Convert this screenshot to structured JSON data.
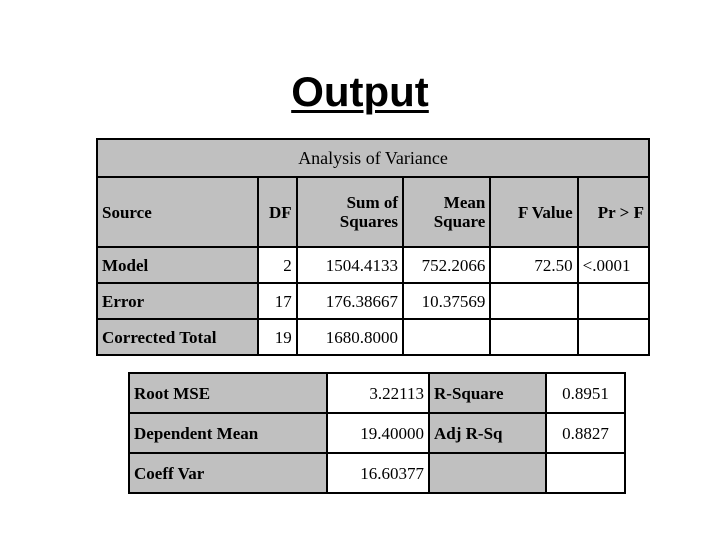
{
  "slide": {
    "title": "Output",
    "background_color": "#ffffff",
    "header_fill_color": "#c0c0c0",
    "border_color": "#000000"
  },
  "anova": {
    "caption": "Analysis of Variance",
    "columns": [
      {
        "line1": "",
        "line2": "Source"
      },
      {
        "line1": "",
        "line2": "DF"
      },
      {
        "line1": "Sum of",
        "line2": "Squares"
      },
      {
        "line1": "Mean",
        "line2": "Square"
      },
      {
        "line1": "",
        "line2": "F Value"
      },
      {
        "line1": "",
        "line2": "Pr > F"
      }
    ],
    "rows": [
      {
        "source": "Model",
        "df": "2",
        "sum_of_squares": "1504.4133",
        "mean_square": "752.2066",
        "f_value": "72.50",
        "pr_f": "<.0001"
      },
      {
        "source": "Error",
        "df": "17",
        "sum_of_squares": "176.38667",
        "mean_square": "10.37569",
        "f_value": "",
        "pr_f": ""
      },
      {
        "source": "Corrected Total",
        "df": "19",
        "sum_of_squares": "1680.8000",
        "mean_square": "",
        "f_value": "",
        "pr_f": ""
      }
    ]
  },
  "fit_statistics": {
    "rows": [
      {
        "label_left": "Root MSE",
        "value_left": "3.22113",
        "label_right": "R-Square",
        "value_right": "0.8951"
      },
      {
        "label_left": "Dependent Mean",
        "value_left": "19.40000",
        "label_right": "Adj R-Sq",
        "value_right": "0.8827"
      },
      {
        "label_left": "Coeff Var",
        "value_left": "16.60377",
        "label_right": "",
        "value_right": ""
      }
    ]
  }
}
